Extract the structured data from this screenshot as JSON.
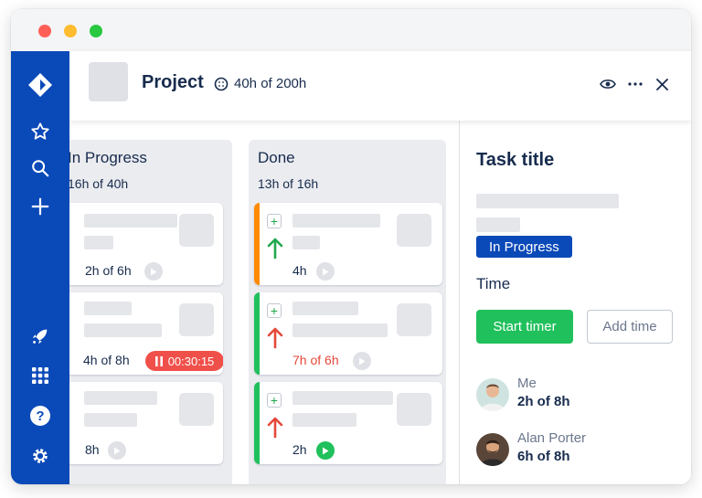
{
  "window": {
    "controls": [
      "close",
      "minimize",
      "maximize"
    ]
  },
  "sidebar": {
    "items": [
      {
        "icon": "app-logo-icon"
      },
      {
        "icon": "star-icon"
      },
      {
        "icon": "search-icon"
      },
      {
        "icon": "plus-icon"
      },
      {
        "icon": "rocket-icon"
      },
      {
        "icon": "apps-grid-icon"
      },
      {
        "icon": "help-icon"
      },
      {
        "icon": "settings-icon"
      }
    ]
  },
  "header": {
    "title": "Project",
    "time_summary": "40h of 200h",
    "actions": [
      "eye-icon",
      "more-icon",
      "close-icon"
    ]
  },
  "board": {
    "columns": [
      {
        "title": "In Progress",
        "subtitle": "16h of 40h",
        "cards": [
          {
            "estimate": "2h of 6h"
          },
          {
            "estimate": "4h of 8h",
            "timer": "00:30:15"
          },
          {
            "estimate": "8h"
          }
        ]
      },
      {
        "title": "Done",
        "subtitle": "13h of 16h",
        "cards": [
          {
            "estimate": "4h",
            "stripe_color": "#ff8b00",
            "priority": "low"
          },
          {
            "estimate": "7h of 6h",
            "stripe_color": "#20c05c",
            "priority": "high",
            "over_estimate": true
          },
          {
            "estimate": "2h",
            "stripe_color": "#20c05c",
            "priority": "high",
            "timer_active": true
          }
        ]
      }
    ]
  },
  "panel": {
    "task_title": "Task title",
    "status": "In Progress",
    "time_label": "Time",
    "start_timer_label": "Start timer",
    "add_time_label": "Add time",
    "users": [
      {
        "name": "Me",
        "time": "2h of 8h"
      },
      {
        "name": "Alan Porter",
        "time": "6h of 8h"
      }
    ]
  },
  "colors": {
    "sidebar": "#0a49b8",
    "accent_green": "#20c05c",
    "timer_red": "#f0504a",
    "stripe_orange": "#ff8b00"
  }
}
